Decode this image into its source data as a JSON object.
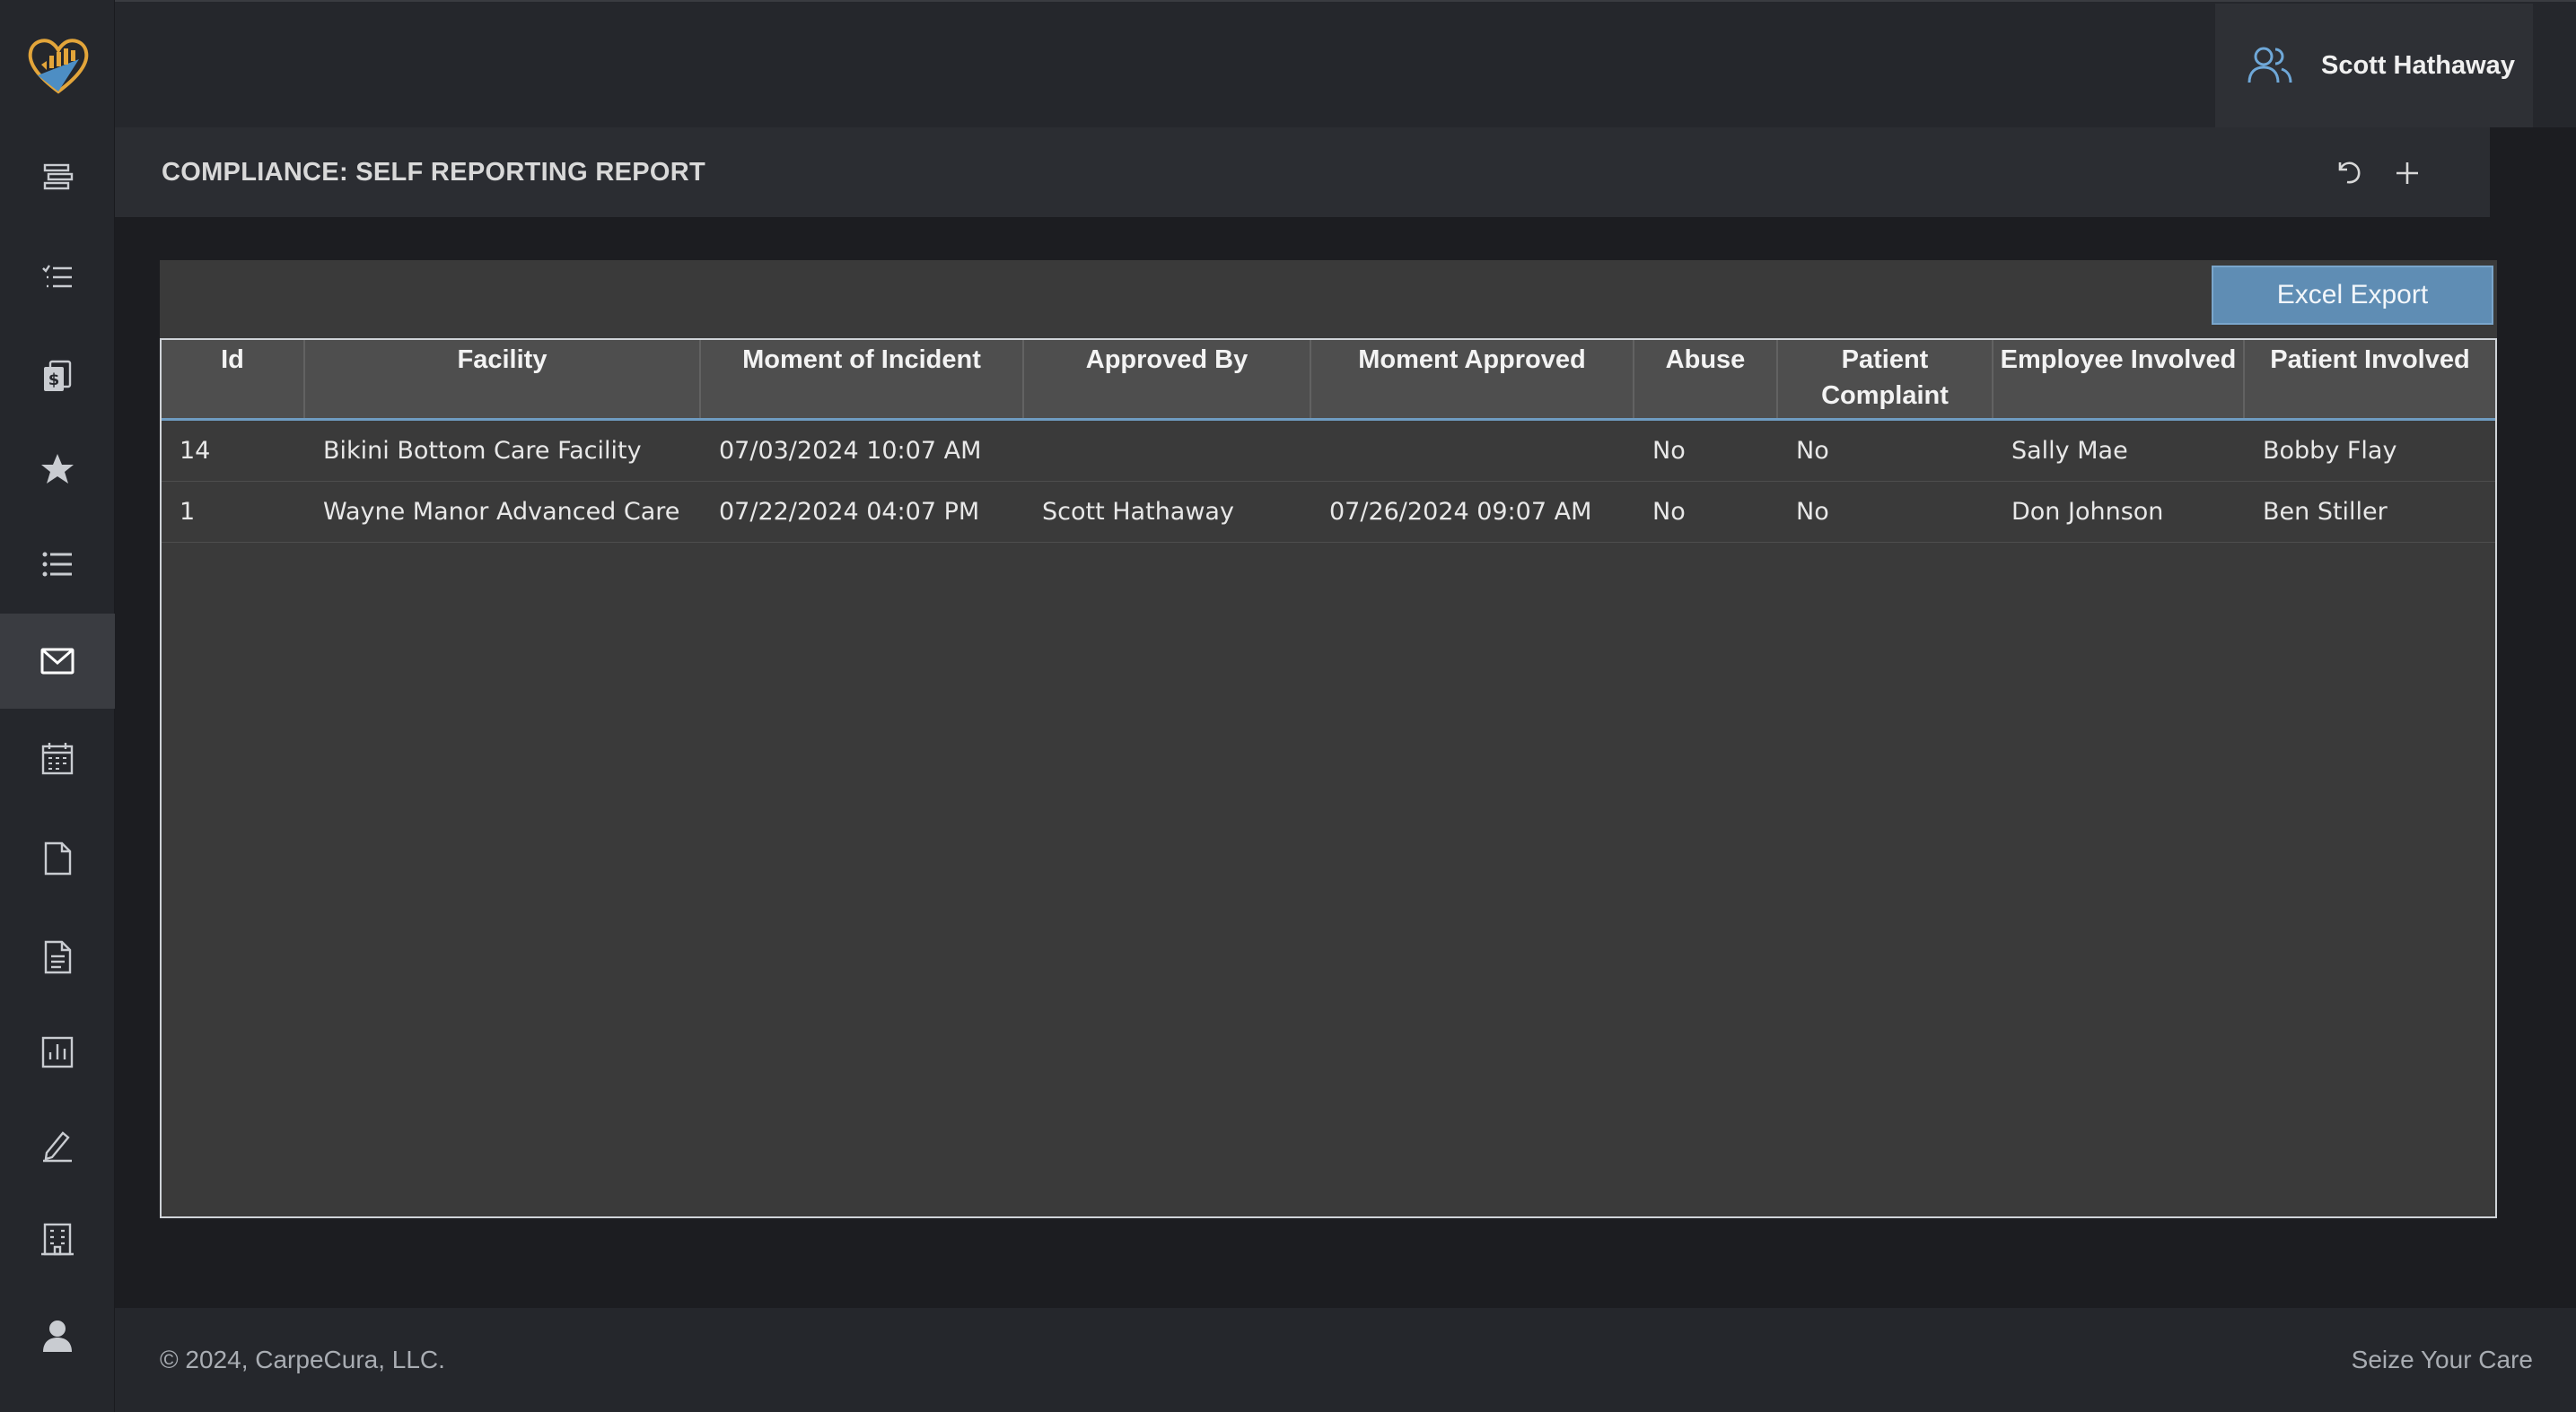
{
  "app": {
    "user_name": "Scott Hathaway"
  },
  "sidebar": {
    "items": [
      {
        "name": "dashboard",
        "icon": "stacked-bars-icon"
      },
      {
        "name": "tasks",
        "icon": "checklist-icon"
      },
      {
        "name": "billing",
        "icon": "dollar-document-icon"
      },
      {
        "name": "favorites",
        "icon": "star-icon"
      },
      {
        "name": "lists",
        "icon": "list-icon"
      },
      {
        "name": "messages",
        "icon": "envelope-icon",
        "active": true
      },
      {
        "name": "calendar",
        "icon": "calendar-icon"
      },
      {
        "name": "files",
        "icon": "blank-document-icon"
      },
      {
        "name": "documents",
        "icon": "text-document-icon"
      },
      {
        "name": "reports",
        "icon": "bar-chart-icon"
      },
      {
        "name": "edit",
        "icon": "pencil-icon"
      },
      {
        "name": "facilities",
        "icon": "building-icon"
      },
      {
        "name": "profile",
        "icon": "person-icon"
      }
    ]
  },
  "page": {
    "title": "COMPLIANCE: SELF REPORTING REPORT",
    "excel_export_label": "Excel Export"
  },
  "table": {
    "columns": [
      "Id",
      "Facility",
      "Moment of Incident",
      "Approved By",
      "Moment Approved",
      "Abuse",
      "Patient Complaint",
      "Employee Involved",
      "Patient Involved"
    ],
    "rows": [
      [
        "14",
        "Bikini Bottom Care Facility",
        "07/03/2024 10:07 AM",
        "",
        "",
        "No",
        "No",
        "Sally Mae",
        "Bobby Flay"
      ],
      [
        "1",
        "Wayne Manor Advanced Care",
        "07/22/2024 04:07 PM",
        "Scott Hathaway",
        "07/26/2024 09:07 AM",
        "No",
        "No",
        "Don Johnson",
        "Ben Stiller"
      ]
    ]
  },
  "footer": {
    "copyright": "© 2024, CarpeCura, LLC.",
    "tagline": "Seize Your Care"
  },
  "colors": {
    "accent": "#5f8db4",
    "logo_gold": "#e3a53a",
    "logo_blue": "#4d8ec4"
  }
}
